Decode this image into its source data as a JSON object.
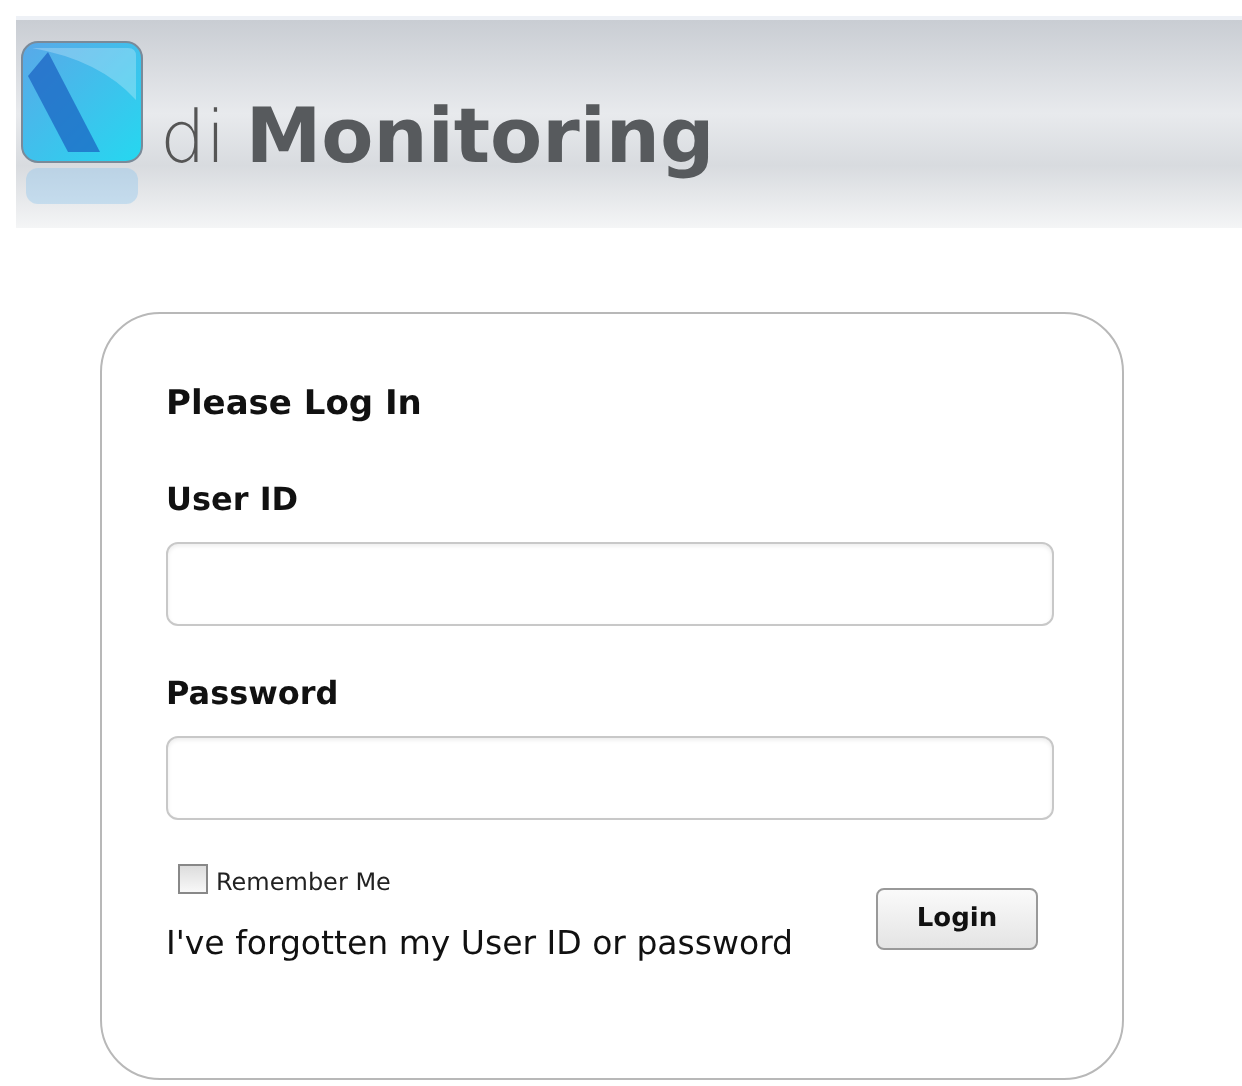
{
  "header": {
    "brand_prefix": "di",
    "brand_name": "Monitoring"
  },
  "login": {
    "title": "Please Log In",
    "fields": [
      {
        "label": "User ID"
      },
      {
        "label": "Password"
      }
    ],
    "remember": {
      "label": "Remember Me",
      "checked": false
    },
    "button": "Login",
    "forgot_link": "I've forgotten my User ID or password"
  }
}
